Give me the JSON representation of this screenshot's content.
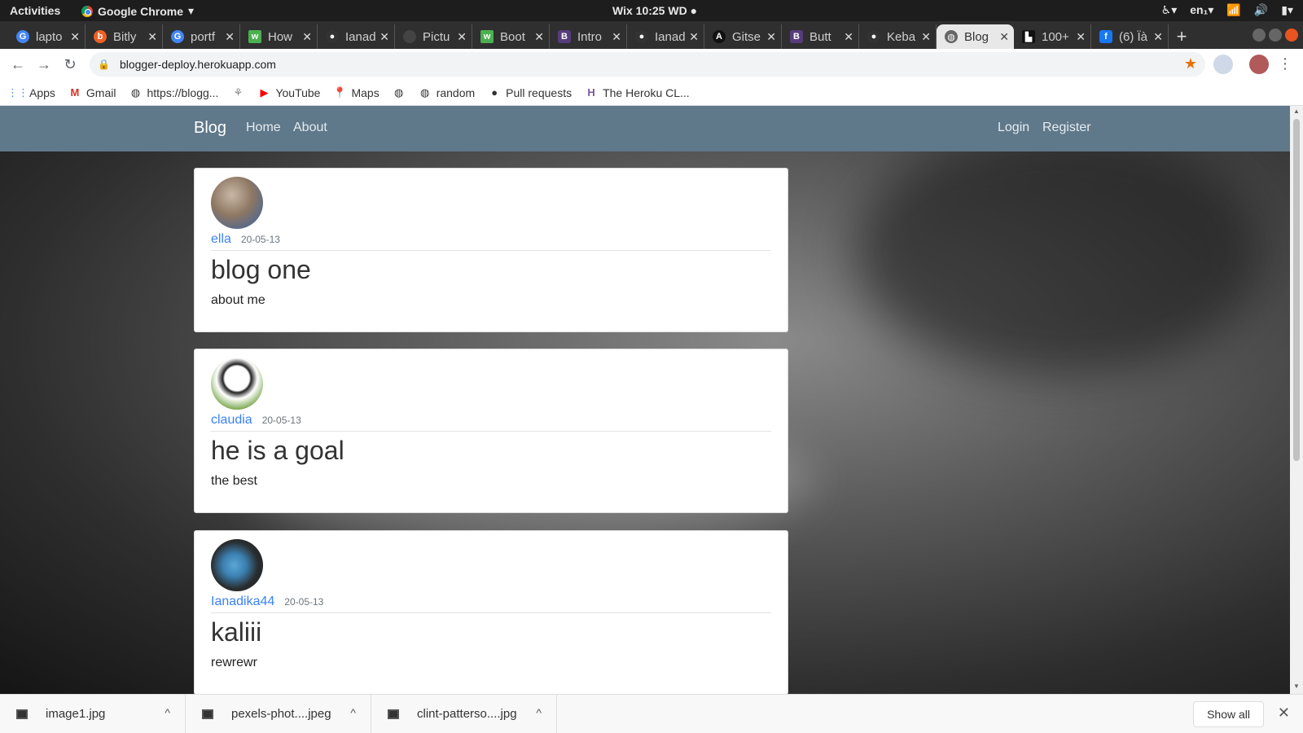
{
  "topbar": {
    "activities": "Activities",
    "app_name": "Google Chrome",
    "clock": "Wix 10:25 WD ●",
    "lang": "en₁"
  },
  "tabs": [
    {
      "label": "lapto",
      "icon": "google-icon",
      "color": "#4285f4"
    },
    {
      "label": "Bitly",
      "icon": "bitly-icon",
      "color": "#ee6123"
    },
    {
      "label": "portf",
      "icon": "google-icon",
      "color": "#4285f4"
    },
    {
      "label": "How",
      "icon": "w3-icon",
      "color": "#4caf50"
    },
    {
      "label": "Ianad",
      "icon": "github-icon",
      "color": "#333333"
    },
    {
      "label": "Pictu",
      "icon": "blank-icon",
      "color": "#444444"
    },
    {
      "label": "Boot",
      "icon": "w3-icon",
      "color": "#4caf50"
    },
    {
      "label": "Intro",
      "icon": "bootstrap-icon",
      "color": "#563d7c"
    },
    {
      "label": "Ianad",
      "icon": "github-icon",
      "color": "#333333"
    },
    {
      "label": "Gitse",
      "icon": "gitsearch-icon",
      "color": "#111111"
    },
    {
      "label": "Butt",
      "icon": "bootstrap-icon",
      "color": "#563d7c"
    },
    {
      "label": "Keba",
      "icon": "github-icon",
      "color": "#333333"
    },
    {
      "label": "Blog",
      "icon": "globe-icon",
      "color": "#666666",
      "active": true
    },
    {
      "label": "100+",
      "icon": "unsplash-icon",
      "color": "#111111"
    },
    {
      "label": "(6) Ïà",
      "icon": "facebook-icon",
      "color": "#1877f2"
    }
  ],
  "address": {
    "url": "blogger-deploy.herokuapp.com"
  },
  "bookmarks": [
    {
      "label": "Apps",
      "icon": "apps-grid-icon"
    },
    {
      "label": "Gmail",
      "icon": "gmail-icon"
    },
    {
      "label": "https://blogg...",
      "icon": "globe-icon"
    },
    {
      "label": "",
      "icon": "plant-icon"
    },
    {
      "label": "YouTube",
      "icon": "youtube-icon"
    },
    {
      "label": "Maps",
      "icon": "maps-pin-icon"
    },
    {
      "label": "",
      "icon": "globe-icon"
    },
    {
      "label": "random",
      "icon": "globe-icon"
    },
    {
      "label": "Pull requests",
      "icon": "github-icon"
    },
    {
      "label": "The Heroku CL...",
      "icon": "heroku-icon"
    }
  ],
  "site": {
    "brand": "Blog",
    "nav": {
      "home": "Home",
      "about": "About",
      "login": "Login",
      "register": "Register"
    },
    "accent": "#5f788a"
  },
  "posts": [
    {
      "author": "ella",
      "date": "20-05-13",
      "title": "blog one",
      "body": "about me"
    },
    {
      "author": "claudia",
      "date": "20-05-13",
      "title": "he is a goal",
      "body": "the best"
    },
    {
      "author": "Ianadika44",
      "date": "20-05-13",
      "title": "kaliii",
      "body": "rewrewr"
    }
  ],
  "downloads": [
    {
      "name": "image1.jpg"
    },
    {
      "name": "pexels-phot....jpeg"
    },
    {
      "name": "clint-patterso....jpg"
    }
  ],
  "shelf": {
    "show_all": "Show all"
  }
}
